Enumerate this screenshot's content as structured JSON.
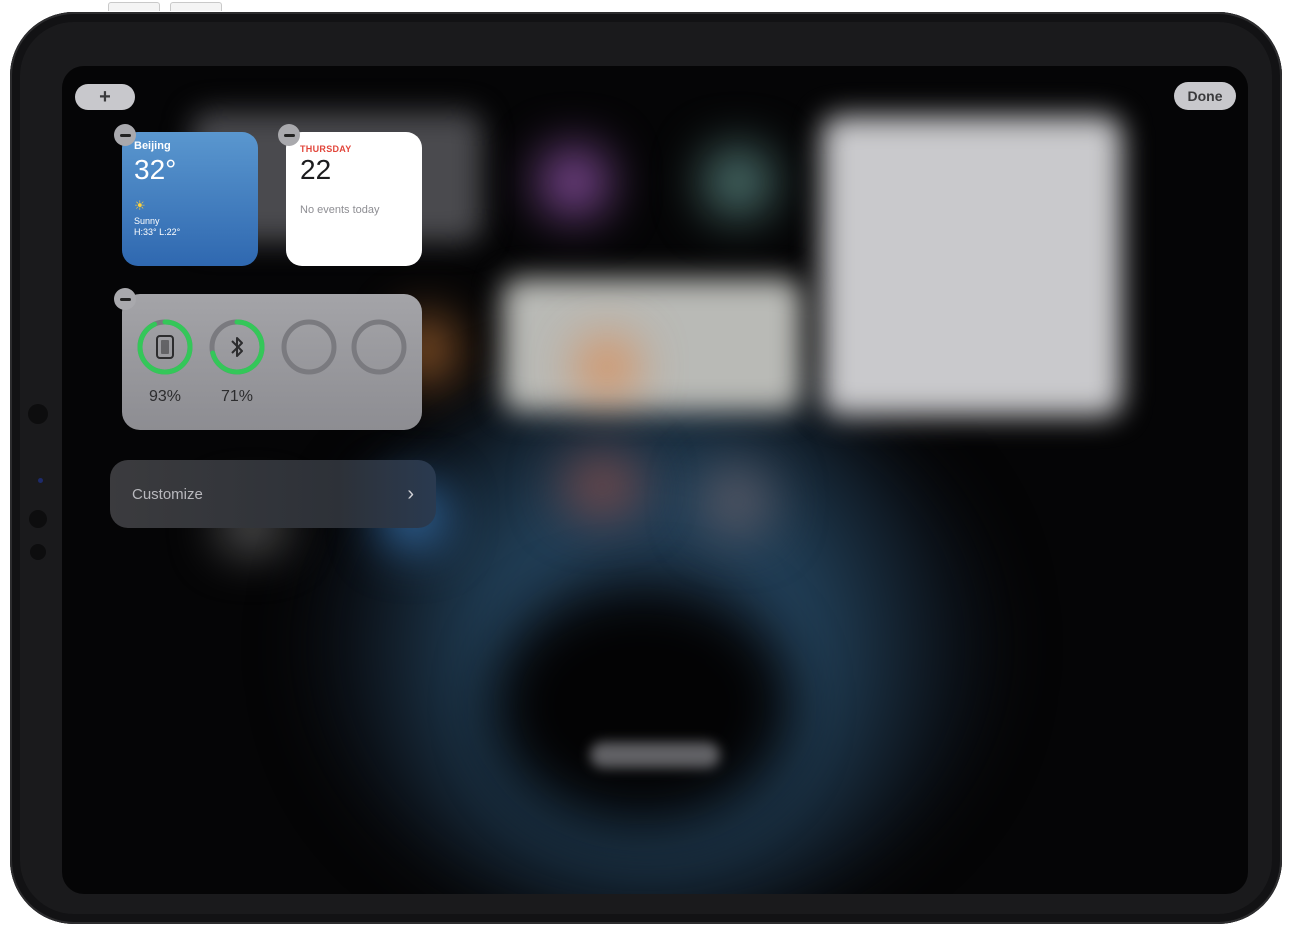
{
  "toolbar": {
    "add_label": "+",
    "done_label": "Done"
  },
  "weather_widget": {
    "city": "Beijing",
    "temperature": "32°",
    "condition": "Sunny",
    "high_low": "H:33° L:22°"
  },
  "calendar_widget": {
    "weekday": "THURSDAY",
    "day": "22",
    "events_text": "No events today"
  },
  "battery_widget": {
    "devices": [
      {
        "name": "ipad",
        "percent_label": "93%",
        "level": 0.93
      },
      {
        "name": "bluetooth",
        "percent_label": "71%",
        "level": 0.71
      }
    ],
    "ring_color": "#34c759"
  },
  "customize_row": {
    "label": "Customize"
  },
  "colors": {
    "weather_bg": "#3a78c0",
    "calendar_accent": "#e2463b"
  }
}
